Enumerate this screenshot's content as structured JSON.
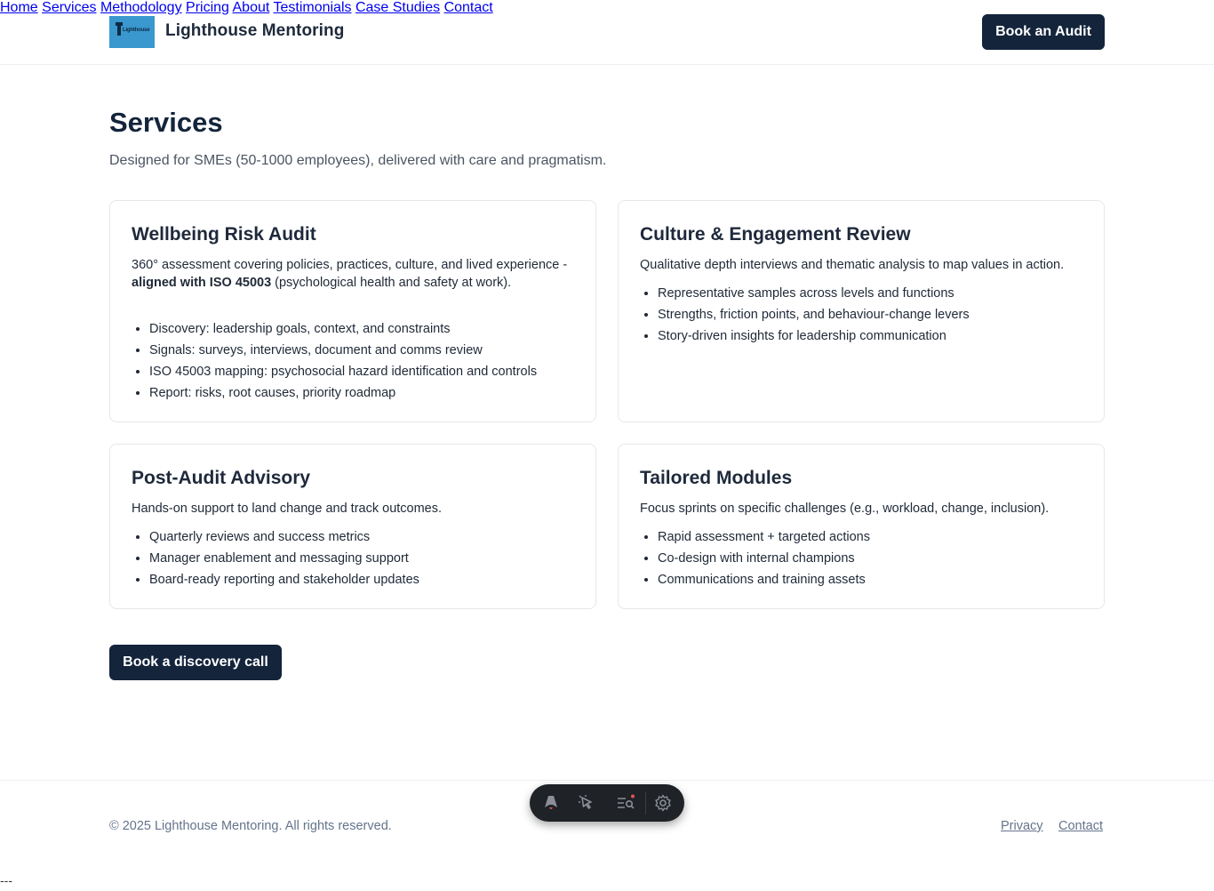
{
  "header": {
    "logo_text": "Lighthouse",
    "brand": "Lighthouse Mentoring",
    "nav": [
      "Home",
      "Services",
      "Methodology",
      "Pricing",
      "About",
      "Testimonials",
      "Case Studies",
      "Contact"
    ],
    "cta": "Book an Audit"
  },
  "main": {
    "title": "Services",
    "subtitle": "Designed for SMEs (50-1000 employees), delivered with care and pragmatism.",
    "cards": [
      {
        "title": "Wellbeing Risk Audit",
        "desc_pre": "360° assessment covering policies, practices, culture, and lived experience - ",
        "desc_bold": "aligned with ISO 45003",
        "desc_post": " (psychological health and safety at work).",
        "items": [
          "Discovery: leadership goals, context, and constraints",
          "Signals: surveys, interviews, document and comms review",
          "ISO 45003 mapping: psychosocial hazard identification and controls",
          "Report: risks, root causes, priority roadmap"
        ]
      },
      {
        "title": "Culture & Engagement Review",
        "desc": "Qualitative depth interviews and thematic analysis to map values in action.",
        "items": [
          "Representative samples across levels and functions",
          "Strengths, friction points, and behaviour-change levers",
          "Story-driven insights for leadership communication"
        ]
      },
      {
        "title": "Post-Audit Advisory",
        "desc": "Hands-on support to land change and track outcomes.",
        "items": [
          "Quarterly reviews and success metrics",
          "Manager enablement and messaging support",
          "Board-ready reporting and stakeholder updates"
        ]
      },
      {
        "title": "Tailored Modules",
        "desc": "Focus sprints on specific challenges (e.g., workload, change, inclusion).",
        "items": [
          "Rapid assessment + targeted actions",
          "Co-design with internal champions",
          "Communications and training assets"
        ]
      }
    ],
    "cta": "Book a discovery call"
  },
  "footer": {
    "copyright": "© 2025 Lighthouse Mentoring. All rights reserved.",
    "links": [
      "Privacy",
      "Contact"
    ]
  },
  "toolbar": {
    "icons": [
      "astro-logo-icon",
      "cursor-select-icon",
      "audit-list-icon",
      "settings-gear-icon"
    ],
    "colors": {
      "background": "#1f2226",
      "icon": "#8b8f96",
      "notification_dot": "#e0525a"
    }
  },
  "stray_text": "---",
  "colors": {
    "primary": "#13243b",
    "heading": "#1e293b",
    "muted": "#64748b",
    "border": "#e5e7eb"
  }
}
